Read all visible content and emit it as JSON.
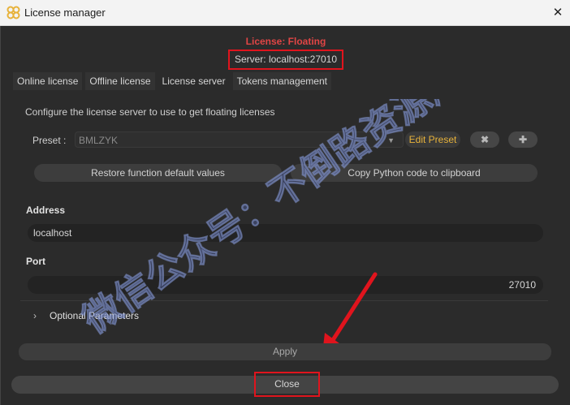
{
  "window": {
    "title": "License manager",
    "close_glyph": "✕"
  },
  "header": {
    "license_type": "License: Floating",
    "server": "Server: localhost:27010"
  },
  "tabs": [
    {
      "label": "Online license"
    },
    {
      "label": "Offline license"
    },
    {
      "label": "License server",
      "active": true
    },
    {
      "label": "Tokens management"
    }
  ],
  "server_panel": {
    "description": "Configure the license server to use to get floating licenses",
    "preset_label": "Preset :",
    "preset_value": "BMLZYK",
    "edit_preset_label": "Edit Preset",
    "remove_glyph": "✖",
    "add_glyph": "✚",
    "restore_label": "Restore function default values",
    "copy_python_label": "Copy Python code to clipboard",
    "address_label": "Address",
    "address_value": "localhost",
    "port_label": "Port",
    "port_value": "27010",
    "optional_label": "Optional Parameters"
  },
  "footer": {
    "apply_label": "Apply",
    "close_label": "Close"
  },
  "watermark": {
    "text": "微信公众号：不倒路资源库"
  },
  "colors": {
    "accent_red": "#e0141d",
    "preset_gold": "#e7b23a",
    "license_red": "#e04545"
  }
}
